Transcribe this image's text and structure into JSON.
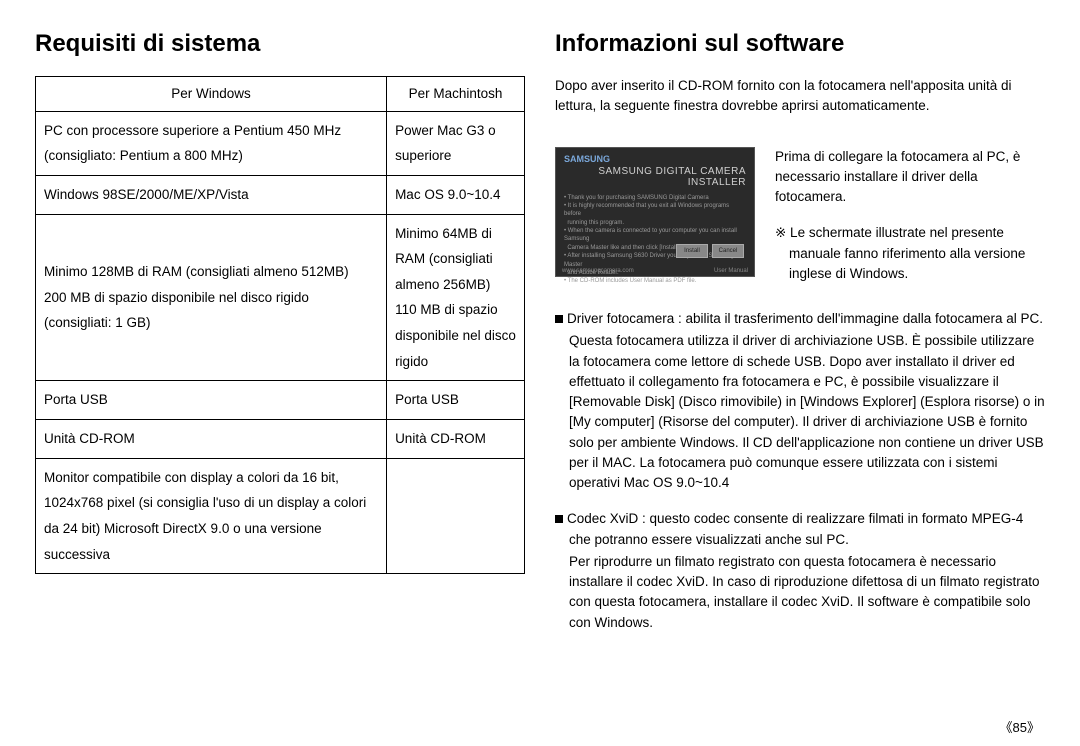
{
  "left": {
    "heading": "Requisiti di sistema",
    "header_win": "Per Windows",
    "header_mac": "Per Machintosh",
    "row1_win": "PC con processore superiore a Pentium 450 MHz\n(consigliato: Pentium a 800 MHz)",
    "row1_mac": "Power Mac G3 o superiore",
    "row2_win": "Windows 98SE/2000/ME/XP/Vista",
    "row2_mac": "Mac OS 9.0~10.4",
    "row3_win": "Minimo 128MB di RAM (consigliati almeno 512MB)\n200 MB di spazio disponibile nel disco rigido (consigliati: 1 GB)",
    "row3_mac": "Minimo 64MB di RAM (consigliati almeno 256MB)\n110 MB di spazio disponibile nel disco rigido",
    "row4_win": "Porta USB",
    "row4_mac": "Porta USB",
    "row5_win": "Unità CD-ROM",
    "row5_mac": "Unità CD-ROM",
    "row6_win": "Monitor compatibile con display a colori da 16 bit, 1024x768 pixel (si consiglia l'uso di un display a colori da 24 bit) Microsoft DirectX 9.0 o una versione successiva",
    "row6_mac": ""
  },
  "right": {
    "heading": "Informazioni sul software",
    "intro": "Dopo aver inserito il CD-ROM fornito con la fotocamera nell'apposita unità di lettura, la seguente finestra dovrebbe aprirsi automaticamente.",
    "installer_title": "SAMSUNG DIGITAL CAMERA INSTALLER",
    "installer_btn1": "Install",
    "installer_btn2": "Cancel",
    "installer_footer_right": "User Manual",
    "side1": "Prima di collegare la fotocamera al PC, è necessario installare il driver della fotocamera.",
    "note": "※ Le schermate illustrate nel presente manuale fanno riferimento alla versione inglese di Windows.",
    "s1_head": "Driver fotocamera : abilita il trasferimento dell'immagine dalla fotocamera al PC.",
    "s1_body": "Questa fotocamera utilizza il driver di archiviazione USB. È possibile utilizzare la fotocamera come lettore di schede USB. Dopo aver installato il driver ed effettuato il collegamento fra fotocamera e PC, è possibile visualizzare il [Removable Disk] (Disco rimovibile) in [Windows Explorer] (Esplora risorse) o in [My computer] (Risorse del computer). Il driver di archiviazione USB è fornito solo per ambiente Windows. Il CD dell'applicazione non contiene un driver USB per il MAC. La fotocamera può comunque essere utilizzata con i sistemi operativi Mac OS 9.0~10.4",
    "s2_head": "Codec XviD : questo codec consente di realizzare filmati in formato MPEG-4 che potranno essere visualizzati anche sul PC.",
    "s2_body": "Per riprodurre un filmato registrato con questa fotocamera è necessario installare il codec XviD. In caso di riproduzione difettosa di un filmato registrato con questa fotocamera, installare il codec XviD. Il software è compatibile solo con Windows."
  },
  "page_num": "《85》"
}
